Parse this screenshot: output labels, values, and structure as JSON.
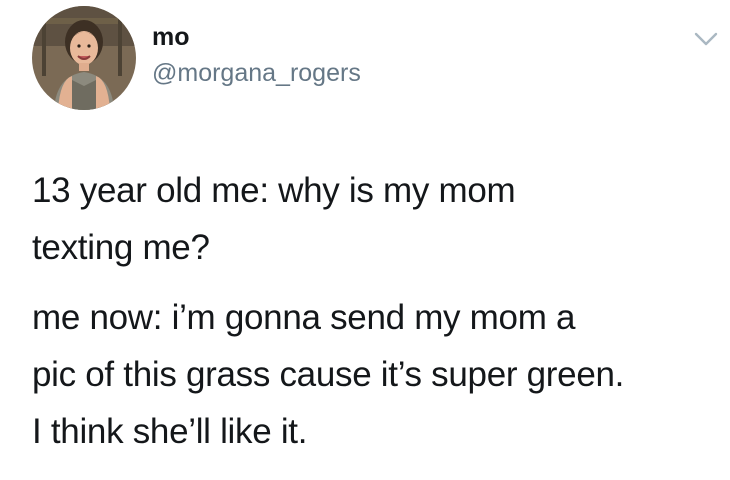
{
  "author": {
    "display_name": "mo",
    "handle": "@morgana_rogers",
    "avatar_icon": "profile-photo"
  },
  "menu": {
    "icon": "chevron-down-icon"
  },
  "tweet": {
    "paragraphs": [
      {
        "lines": [
          "13 year old me: why is my mom",
          "texting me?"
        ]
      },
      {
        "lines": [
          "me now: i’m gonna send my mom a",
          "pic of this grass cause it’s super green.",
          "I think she’ll like it."
        ]
      }
    ]
  },
  "colors": {
    "text": "#14171a",
    "secondary": "#657786",
    "caret": "#aab8c2"
  }
}
